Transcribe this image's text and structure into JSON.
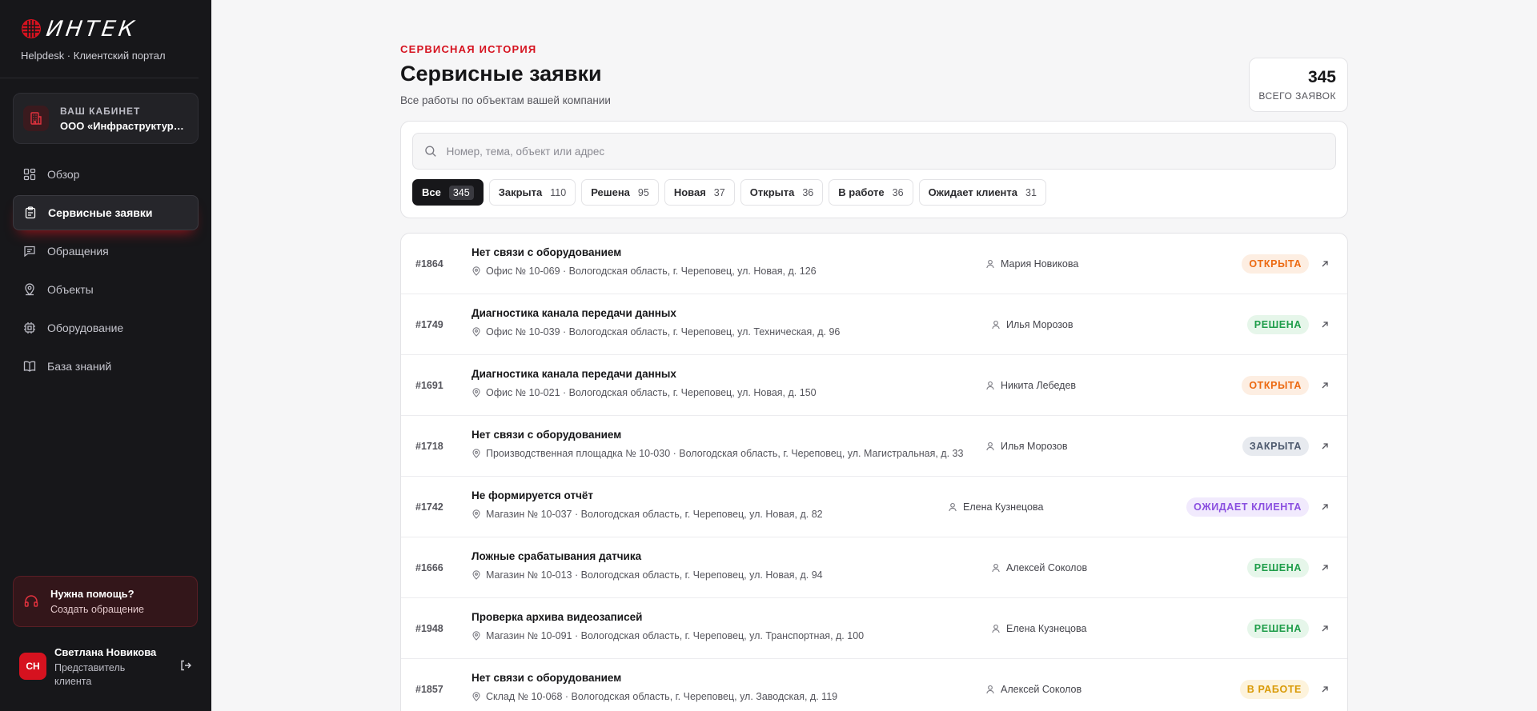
{
  "brand": {
    "logo_text": "ИНТЕК",
    "subtitle": "Helpdesk · Клиентский портал"
  },
  "cabinet": {
    "label": "ВАШ КАБИНЕТ",
    "company": "ООО «Инфраструктура п..."
  },
  "nav": [
    {
      "label": "Обзор",
      "icon": "grid-icon"
    },
    {
      "label": "Сервисные заявки",
      "icon": "clipboard-icon",
      "active": true
    },
    {
      "label": "Обращения",
      "icon": "chat-icon"
    },
    {
      "label": "Объекты",
      "icon": "map-pin-icon"
    },
    {
      "label": "Оборудование",
      "icon": "cpu-icon"
    },
    {
      "label": "База знаний",
      "icon": "book-icon"
    }
  ],
  "help": {
    "title": "Нужна помощь?",
    "link": "Создать обращение"
  },
  "user": {
    "initials": "СН",
    "name": "Светлана Новикова",
    "role": "Представитель клиента"
  },
  "header": {
    "eyebrow": "СЕРВИСНАЯ ИСТОРИЯ",
    "title": "Сервисные заявки",
    "subtitle": "Все работы по объектам вашей компании",
    "total_value": "345",
    "total_label": "ВСЕГО ЗАЯВОК"
  },
  "search": {
    "placeholder": "Номер, тема, объект или адрес"
  },
  "filters": [
    {
      "label": "Все",
      "count": "345",
      "active": true
    },
    {
      "label": "Закрыта",
      "count": "110"
    },
    {
      "label": "Решена",
      "count": "95"
    },
    {
      "label": "Новая",
      "count": "37"
    },
    {
      "label": "Открыта",
      "count": "36"
    },
    {
      "label": "В работе",
      "count": "36"
    },
    {
      "label": "Ожидает клиента",
      "count": "31"
    }
  ],
  "tickets": [
    {
      "id": "#1864",
      "title": "Нет связи с оборудованием",
      "address": "Офис № 10-069 · Вологодская область, г. Череповец, ул. Новая, д. 126",
      "person": "Мария Новикова",
      "status": "ОТКРЫТА",
      "status_kind": "open"
    },
    {
      "id": "#1749",
      "title": "Диагностика канала передачи данных",
      "address": "Офис № 10-039 · Вологодская область, г. Череповец, ул. Техническая, д. 96",
      "person": "Илья Морозов",
      "status": "РЕШЕНА",
      "status_kind": "solved"
    },
    {
      "id": "#1691",
      "title": "Диагностика канала передачи данных",
      "address": "Офис № 10-021 · Вологодская область, г. Череповец, ул. Новая, д. 150",
      "person": "Никита Лебедев",
      "status": "ОТКРЫТА",
      "status_kind": "open"
    },
    {
      "id": "#1718",
      "title": "Нет связи с оборудованием",
      "address": "Производственная площадка № 10-030 · Вологодская область, г. Череповец, ул. Магистральная, д. 33",
      "person": "Илья Морозов",
      "status": "ЗАКРЫТА",
      "status_kind": "closed"
    },
    {
      "id": "#1742",
      "title": "Не формируется отчёт",
      "address": "Магазин № 10-037 · Вологодская область, г. Череповец, ул. Новая, д. 82",
      "person": "Елена Кузнецова",
      "status": "ОЖИДАЕТ КЛИЕНТА",
      "status_kind": "wait"
    },
    {
      "id": "#1666",
      "title": "Ложные срабатывания датчика",
      "address": "Магазин № 10-013 · Вологодская область, г. Череповец, ул. Новая, д. 94",
      "person": "Алексей Соколов",
      "status": "РЕШЕНА",
      "status_kind": "solved"
    },
    {
      "id": "#1948",
      "title": "Проверка архива видеозаписей",
      "address": "Магазин № 10-091 · Вологодская область, г. Череповец, ул. Транспортная, д. 100",
      "person": "Елена Кузнецова",
      "status": "РЕШЕНА",
      "status_kind": "solved"
    },
    {
      "id": "#1857",
      "title": "Нет связи с оборудованием",
      "address": "Склад № 10-068 · Вологодская область, г. Череповец, ул. Заводская, д. 119",
      "person": "Алексей Соколов",
      "status": "В РАБОТЕ",
      "status_kind": "work"
    }
  ]
}
